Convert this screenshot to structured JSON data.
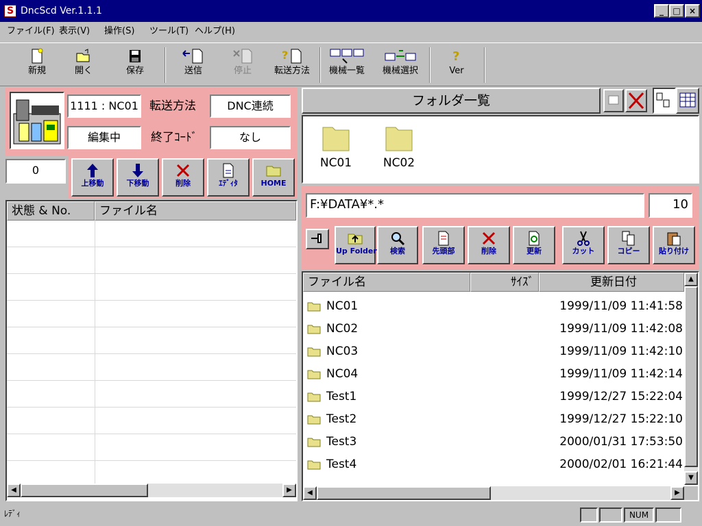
{
  "window": {
    "title": "DncScd Ver.1.1.1",
    "icon_letter": "S"
  },
  "menu": [
    "ファイル(F)",
    "表示(V)",
    "操作(S)",
    "ツール(T)",
    "ヘルプ(H)"
  ],
  "toolbar": {
    "new": "新規",
    "open": "開く",
    "save": "保存",
    "send": "送信",
    "stop": "停止",
    "transfer_method": "転送方法",
    "machine_list": "機械一覧",
    "machine_select": "機械選択",
    "ver": "Ver"
  },
  "left": {
    "machine": "1111 : NC01",
    "transfer_label": "転送方法",
    "transfer_value": "DNC連続",
    "status": "編集中",
    "exit_label": "終了ｺｰﾄﾞ",
    "exit_value": "なし",
    "counter": "0",
    "buttons": {
      "up": "上移動",
      "down": "下移動",
      "delete": "削除",
      "editor": "ｴﾃﾞｨﾀ",
      "home": "HOME"
    },
    "columns": {
      "status": "状態 & No.",
      "filename": "ファイル名"
    }
  },
  "right": {
    "folder_header": "フォルダ一覧",
    "folders": [
      "NC01",
      "NC02"
    ],
    "path": "F:¥DATA¥*.*",
    "count": "10",
    "buttons": {
      "up_folder": "Up Folder",
      "search": "検索",
      "head": "先頭部",
      "delete": "削除",
      "refresh": "更新",
      "cut": "カット",
      "copy": "コピー",
      "paste": "貼り付け"
    },
    "columns": {
      "filename": "ファイル名",
      "size": "ｻｲｽﾞ",
      "date": "更新日付"
    },
    "files": [
      {
        "name": "NC01",
        "date": "1999/11/09 11:41:58"
      },
      {
        "name": "NC02",
        "date": "1999/11/09 11:42:08"
      },
      {
        "name": "NC03",
        "date": "1999/11/09 11:42:10"
      },
      {
        "name": "NC04",
        "date": "1999/11/09 11:42:14"
      },
      {
        "name": "Test1",
        "date": "1999/12/27 15:22:04"
      },
      {
        "name": "Test2",
        "date": "1999/12/27 15:22:10"
      },
      {
        "name": "Test3",
        "date": "2000/01/31 17:53:50"
      },
      {
        "name": "Test4",
        "date": "2000/02/01 16:21:44"
      }
    ]
  },
  "status": {
    "text": "ﾚﾃﾞｨ",
    "num": "NUM"
  },
  "colors": {
    "titlebar": "#000080",
    "panel_pink": "#f0a8a8",
    "face": "#c0c0c0",
    "button_label": "#0000a0"
  }
}
